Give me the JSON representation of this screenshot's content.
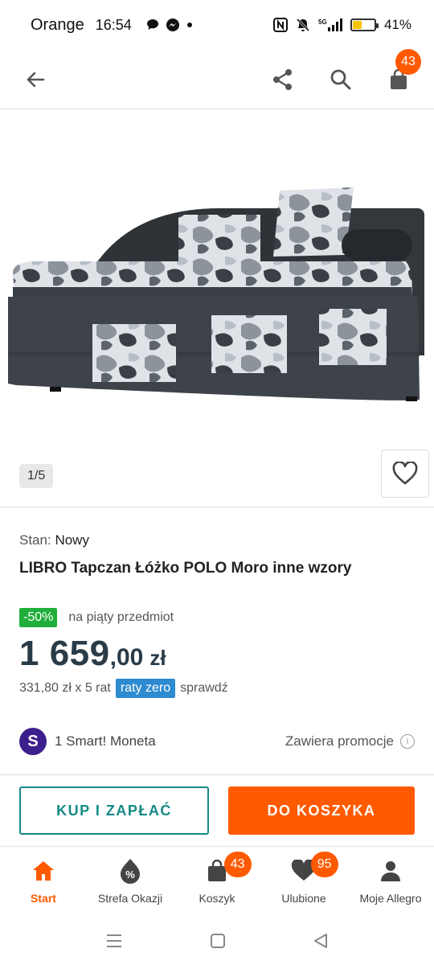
{
  "status_bar": {
    "carrier": "Orange",
    "time": "16:54",
    "battery_percent": "41%",
    "battery_level": 0.41
  },
  "topbar": {
    "cart_count": "43"
  },
  "gallery": {
    "counter": "1/5"
  },
  "product": {
    "condition_label": "Stan:",
    "condition_value": "Nowy",
    "title": "LIBRO Tapczan Łóżko POLO Moro inne wzory",
    "discount_tag": "-50%",
    "discount_text": "na piąty przedmiot",
    "price_main": "1 659",
    "price_decimals": ",00",
    "price_currency": "zł",
    "installment_text": "331,80 zł x 5 rat",
    "raty_tag": "raty zero",
    "check_link": "sprawdź"
  },
  "smart": {
    "logo_letter": "S",
    "text": "1 Smart! Moneta",
    "promo_info": "Zawiera promocje",
    "info_glyph": "i"
  },
  "actions": {
    "buy_label": "KUP I ZAPŁAĆ",
    "cart_label": "DO KOSZYKA"
  },
  "bottom_nav": {
    "items": [
      {
        "label": "Start"
      },
      {
        "label": "Strefa Okazji"
      },
      {
        "label": "Koszyk",
        "badge": "43"
      },
      {
        "label": "Ulubione",
        "badge": "95"
      },
      {
        "label": "Moje Allegro"
      }
    ]
  },
  "colors": {
    "brand_orange": "#ff5a00",
    "teal": "#168a86",
    "discount_green": "#1fae3b",
    "raty_blue": "#2e8bd0"
  }
}
